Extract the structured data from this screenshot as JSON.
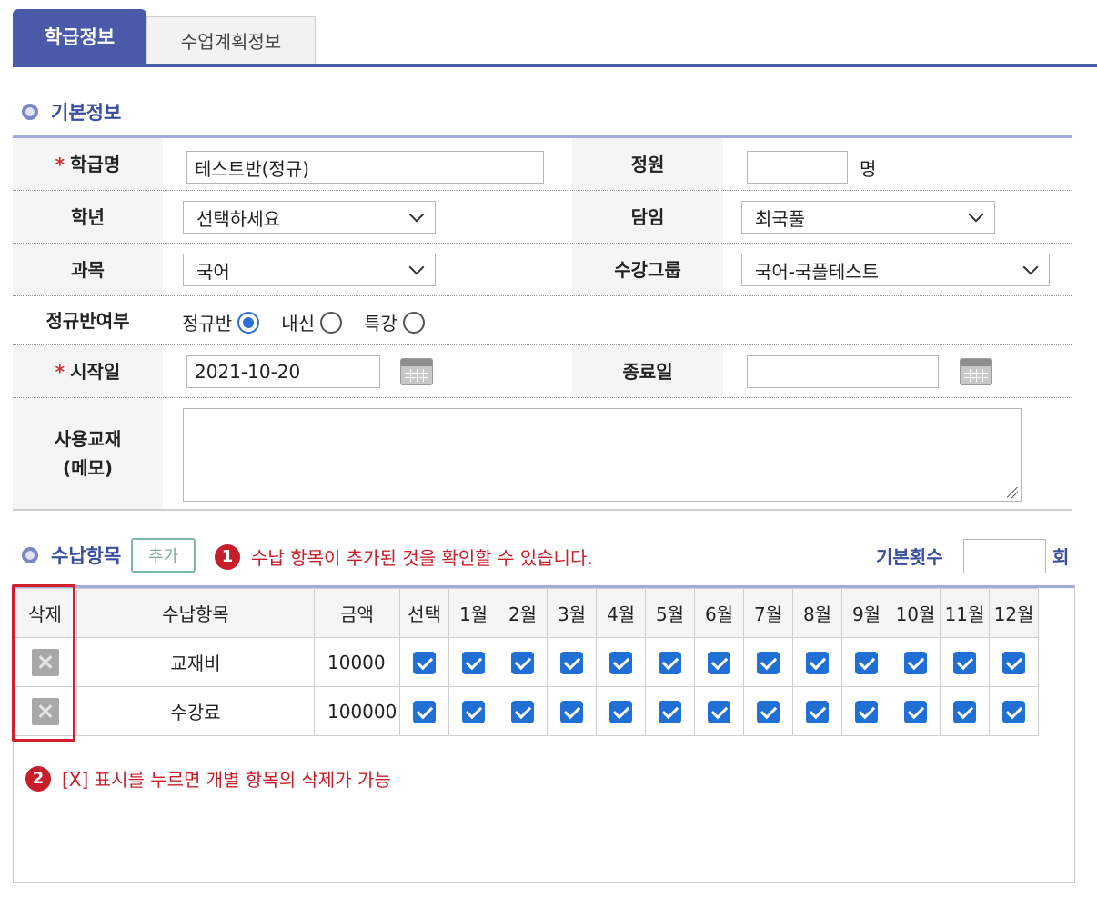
{
  "tabs": [
    {
      "label": "학급정보",
      "active": true
    },
    {
      "label": "수업계획정보",
      "active": false
    }
  ],
  "basic": {
    "section_title": "기본정보",
    "required_mark": "*",
    "class_name": {
      "label": "학급명",
      "value": "테스트반(정규)"
    },
    "capacity": {
      "label": "정원",
      "value": "",
      "unit": "명"
    },
    "grade": {
      "label": "학년",
      "value": "선택하세요"
    },
    "teacher": {
      "label": "담임",
      "value": "최국풀"
    },
    "subject": {
      "label": "과목",
      "value": "국어"
    },
    "course_group": {
      "label": "수강그룹",
      "value": "국어-국풀테스트"
    },
    "regular": {
      "label": "정규반여부",
      "options": [
        {
          "label": "정규반",
          "selected": true
        },
        {
          "label": "내신",
          "selected": false
        },
        {
          "label": "특강",
          "selected": false
        }
      ]
    },
    "start_date": {
      "label": "시작일",
      "value": "2021-10-20"
    },
    "end_date": {
      "label": "종료일",
      "value": ""
    },
    "textbook": {
      "label_line1": "사용교재",
      "label_line2": "(메모)",
      "value": ""
    }
  },
  "payment": {
    "section_title": "수납항목",
    "add_button": "추가",
    "note1": {
      "number": "1",
      "text": "수납 항목이 추가된 것을 확인할 수 있습니다."
    },
    "note2": {
      "number": "2",
      "text": "[X] 표시를 누르면 개별 항목의 삭제가 가능"
    },
    "base_count_label": "기본횟수",
    "base_count_value": "",
    "base_count_unit": "회",
    "headers": {
      "delete": "삭제",
      "item": "수납항목",
      "amount": "금액",
      "select": "선택",
      "months": [
        "1월",
        "2월",
        "3월",
        "4월",
        "5월",
        "6월",
        "7월",
        "8월",
        "9월",
        "10월",
        "11월",
        "12월"
      ]
    },
    "rows": [
      {
        "item": "교재비",
        "amount": "10000"
      },
      {
        "item": "수강료",
        "amount": "100000"
      }
    ]
  },
  "colors": {
    "accent": "#4a5aa8",
    "note_red": "#c81e2a",
    "checkbox": "#1f6fd4"
  }
}
